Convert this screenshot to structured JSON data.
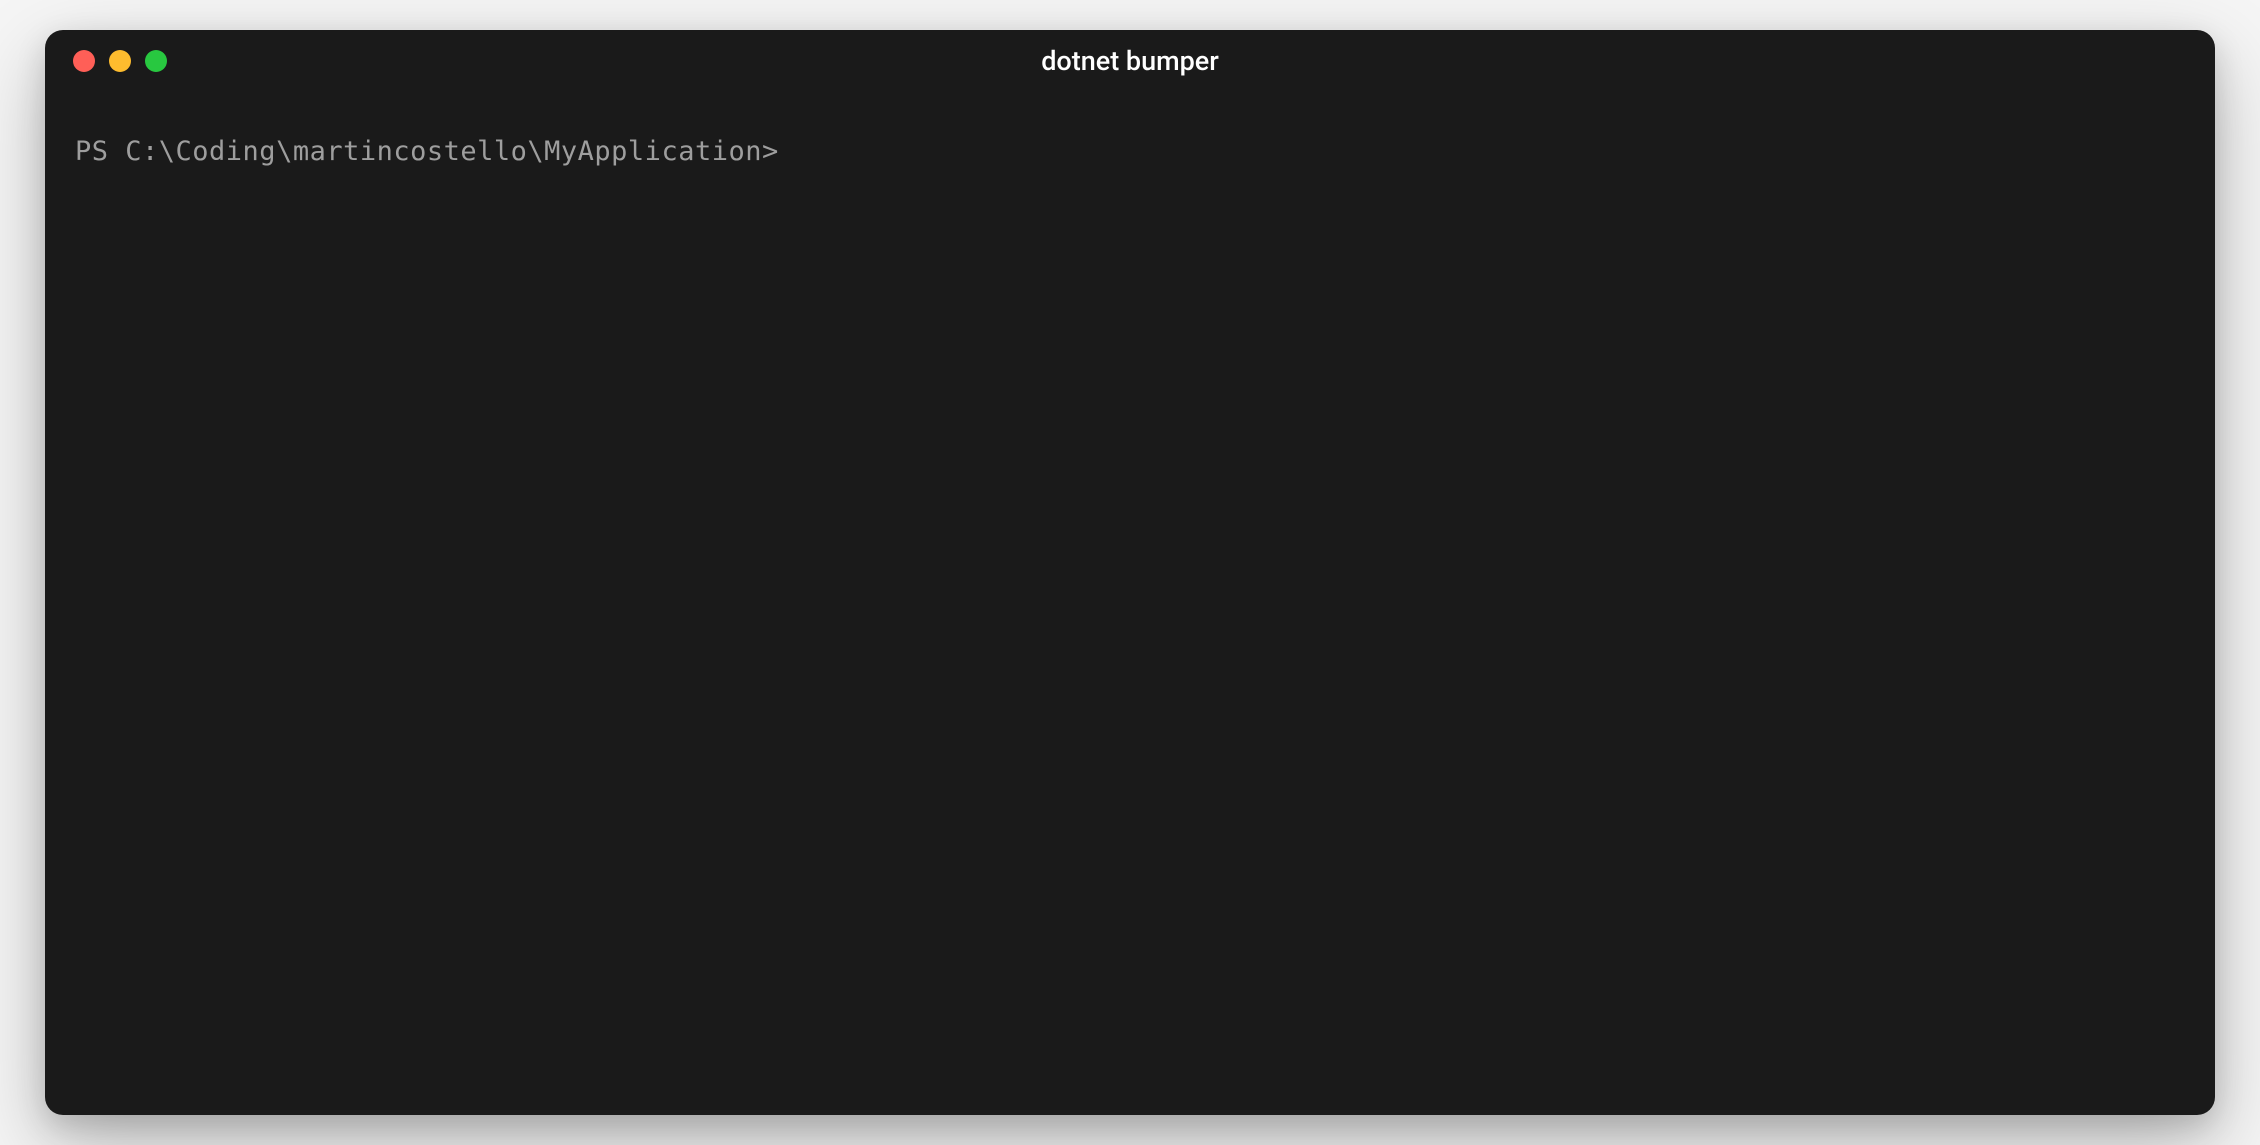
{
  "window": {
    "title": "dotnet bumper"
  },
  "terminal": {
    "prompt": "PS C:\\Coding\\martincostello\\MyApplication>",
    "input_value": ""
  }
}
